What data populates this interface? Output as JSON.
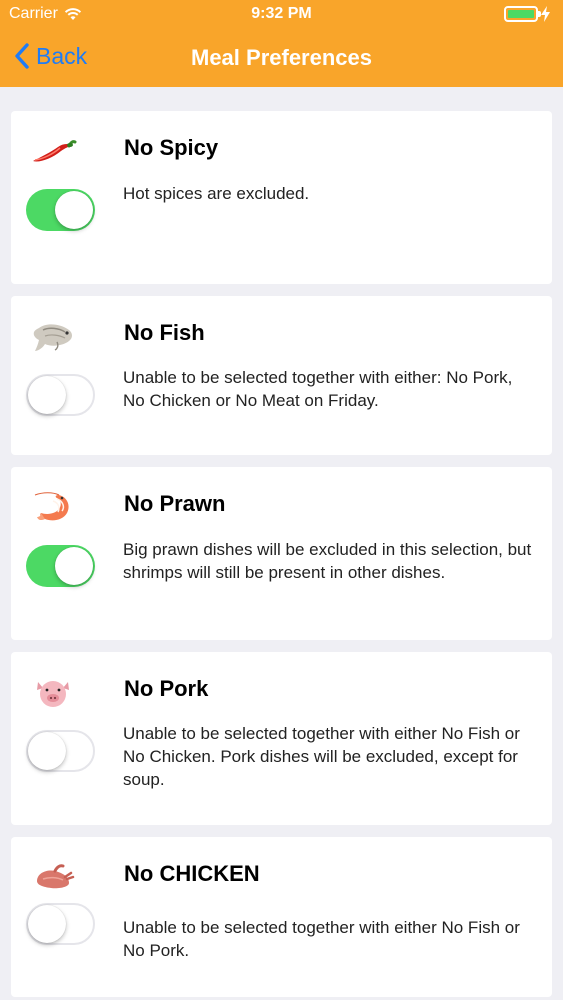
{
  "status_bar": {
    "carrier": "Carrier",
    "time": "9:32 PM",
    "battery_color": "#4cd964"
  },
  "nav": {
    "back_label": "Back",
    "title": "Meal Preferences",
    "background_color": "#f9a52a",
    "back_color": "#1e7cf6"
  },
  "preferences": [
    {
      "title": "No Spicy",
      "icon": "chili-pepper-icon",
      "enabled": true,
      "description": "Hot spices are excluded."
    },
    {
      "title": "No Fish",
      "icon": "fish-icon",
      "enabled": false,
      "description": "Unable to be selected together with either: No Pork, No Chicken or No Meat on Friday."
    },
    {
      "title": "No Prawn",
      "icon": "prawn-icon",
      "enabled": true,
      "description": "Big prawn dishes will be excluded in this selection, but shrimps will still be present in other dishes."
    },
    {
      "title": "No Pork",
      "icon": "pig-icon",
      "enabled": false,
      "description": "Unable to be selected together with either No Fish or No Chicken. Pork dishes will be excluded, except for soup."
    },
    {
      "title": "No CHICKEN",
      "icon": "chicken-icon",
      "enabled": false,
      "description": "Unable to be selected together with either No Fish or No Pork."
    }
  ],
  "colors": {
    "toggle_on": "#4cd964",
    "toggle_off_border": "#e5e5ea",
    "page_background": "#efeff4"
  }
}
